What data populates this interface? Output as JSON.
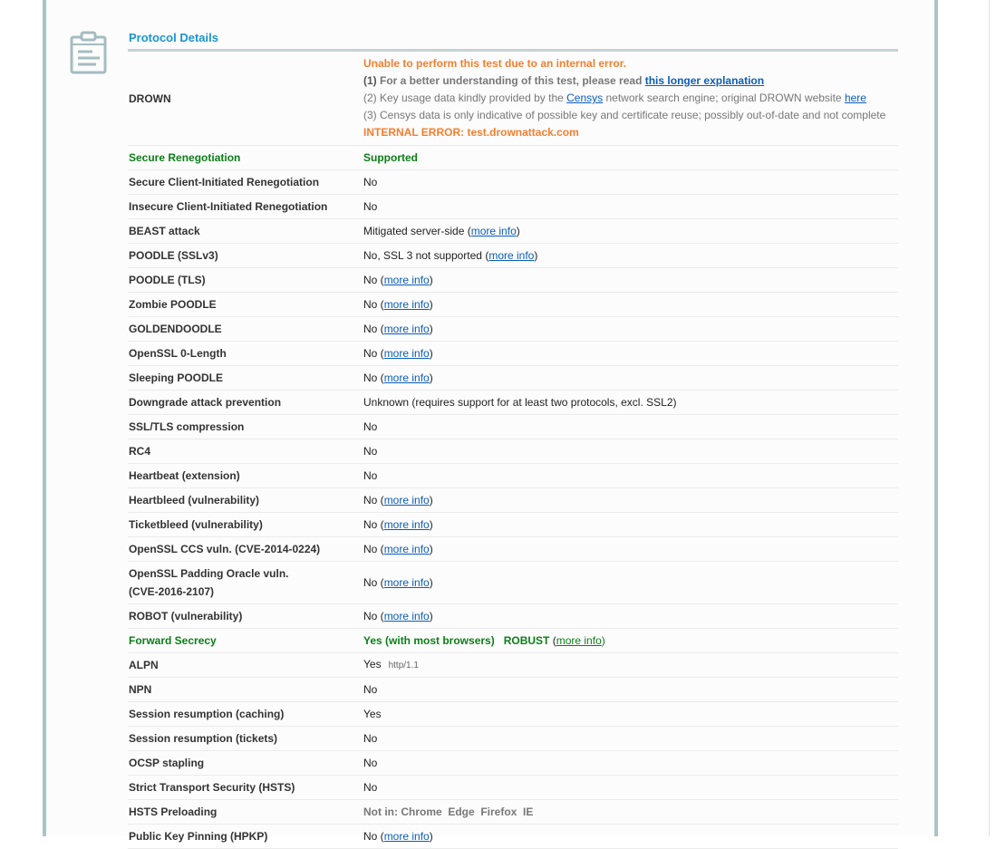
{
  "section": {
    "title": "Protocol Details",
    "icon": "clipboard-icon"
  },
  "drown": {
    "label": "DROWN",
    "error_headline": "Unable to perform this test due to an internal error.",
    "note1_prefix": "(1)",
    "note1_text": " For a better understanding of this test, please read ",
    "note1_link": "this longer explanation",
    "note2_text": "(2) Key usage data kindly provided by the ",
    "note2_link": "Censys",
    "note2_mid": " network search engine; original DROWN website ",
    "note2_link2": "here",
    "note3_text": "(3) Censys data is only indicative of possible key and certificate reuse; possibly out-of-date and not complete",
    "internal_error": "INTERNAL ERROR: test.drownattack.com"
  },
  "more_info": "more info",
  "rows": [
    {
      "label": "Secure Renegotiation",
      "value": "Supported",
      "style": "green"
    },
    {
      "label": "Secure Client-Initiated Renegotiation",
      "value": "No"
    },
    {
      "label": "Insecure Client-Initiated Renegotiation",
      "value": "No"
    },
    {
      "label": "BEAST attack",
      "value": "Mitigated server-side",
      "more_info": true
    },
    {
      "label": "POODLE (SSLv3)",
      "value": "No, SSL 3 not supported",
      "more_info": true
    },
    {
      "label": "POODLE (TLS)",
      "value": "No",
      "more_info": true
    },
    {
      "label": "Zombie POODLE",
      "value": "No",
      "more_info": true
    },
    {
      "label": "GOLDENDOODLE",
      "value": "No",
      "more_info": true
    },
    {
      "label": "OpenSSL 0-Length",
      "value": "No",
      "more_info": true
    },
    {
      "label": "Sleeping POODLE",
      "value": "No",
      "more_info": true
    },
    {
      "label": "Downgrade attack prevention",
      "value": "Unknown (requires support for at least two protocols, excl. SSL2)"
    },
    {
      "label": "SSL/TLS compression",
      "value": "No"
    },
    {
      "label": "RC4",
      "value": "No"
    },
    {
      "label": "Heartbeat (extension)",
      "value": "No"
    },
    {
      "label": "Heartbleed (vulnerability)",
      "value": "No",
      "more_info": true
    },
    {
      "label": "Ticketbleed (vulnerability)",
      "value": "No",
      "more_info": true
    },
    {
      "label": "OpenSSL CCS vuln. (CVE-2014-0224)",
      "value": "No",
      "more_info": true
    },
    {
      "label": "OpenSSL Padding Oracle vuln. (CVE-2016-2107)",
      "label_line1": "OpenSSL Padding Oracle vuln.",
      "label_line2": "(CVE-2016-2107)",
      "value": "No",
      "more_info": true
    },
    {
      "label": "ROBOT (vulnerability)",
      "value": "No",
      "more_info": true
    },
    {
      "label": "Forward Secrecy",
      "value": "Yes (with most browsers)",
      "extra": "ROBUST",
      "more_info": true,
      "style": "green"
    },
    {
      "label": "ALPN",
      "value": "Yes",
      "note": "http/1.1"
    },
    {
      "label": "NPN",
      "value": "No"
    },
    {
      "label": "Session resumption (caching)",
      "value": "Yes"
    },
    {
      "label": "Session resumption (tickets)",
      "value": "No"
    },
    {
      "label": "OCSP stapling",
      "value": "No"
    },
    {
      "label": "Strict Transport Security (HSTS)",
      "value": "No"
    },
    {
      "label": "HSTS Preloading",
      "value": "Not in: Chrome  Edge  Firefox  IE",
      "style": "grey"
    },
    {
      "label": "Public Key Pinning (HPKP)",
      "value": "No",
      "more_info": true
    }
  ]
}
